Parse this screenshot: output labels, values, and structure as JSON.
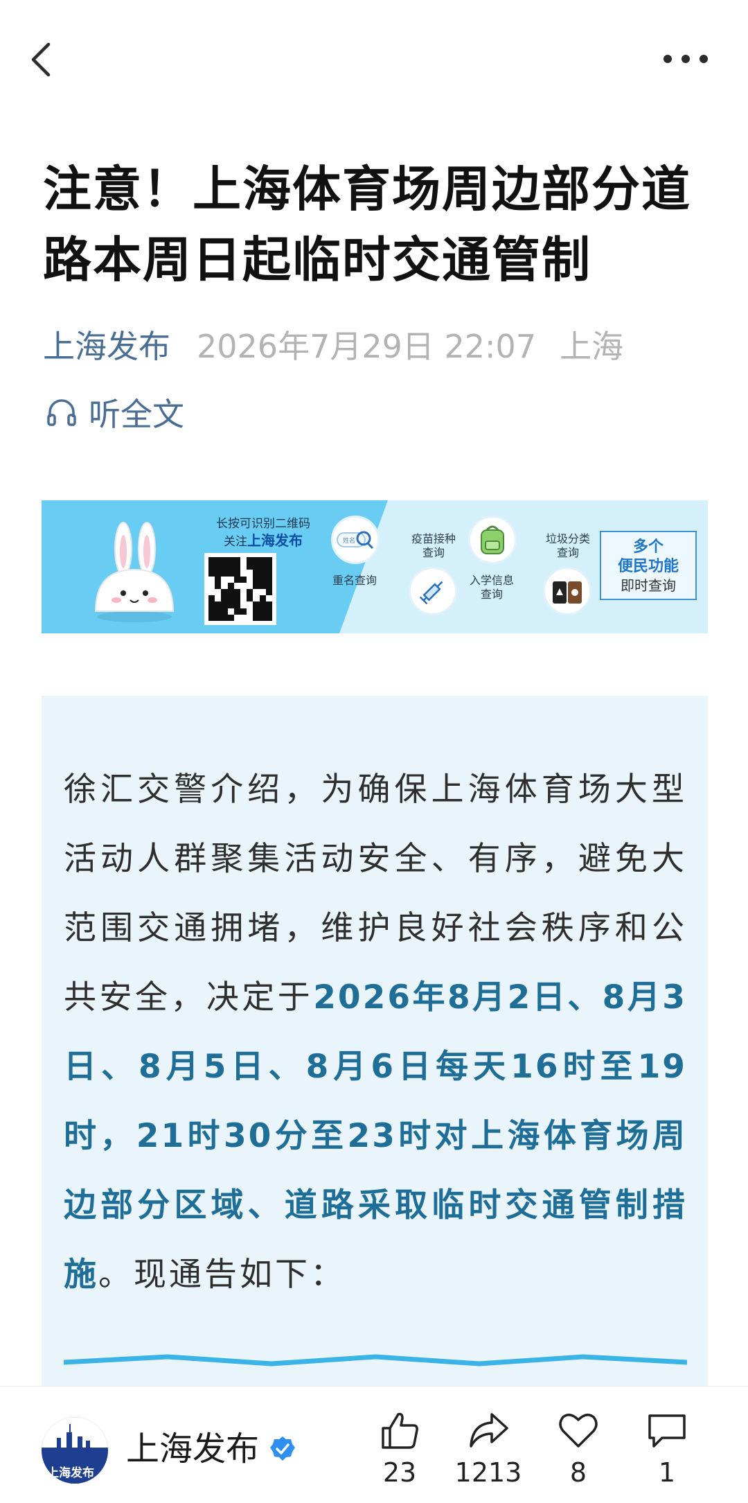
{
  "topbar": {
    "back_icon": "back-chevron-icon",
    "more_icon": "more-dots-icon"
  },
  "article": {
    "title": "注意！上海体育场周边部分道路本周日起临时交通管制",
    "author": "上海发布",
    "date": "2026年7月29日 22:07",
    "location": "上海",
    "listen_label": "听全文"
  },
  "banner": {
    "tagline_line1": "长按可识别二维码",
    "tagline_follow": "关注",
    "tagline_brand": "上海发布",
    "label_name_check": "重名查询",
    "label_vaccine_line1": "疫苗接种",
    "label_vaccine_line2": "查询",
    "label_school_line1": "入学信息",
    "label_school_line2": "查询",
    "label_garbage_line1": "垃圾分类",
    "label_garbage_line2": "查询",
    "box_line1": "多个",
    "box_line2": "便民功能",
    "box_line3": "即时查询",
    "search_chip_text": "姓名"
  },
  "content": {
    "text_before": "徐汇交警介绍，为确保上海体育场大型活动人群聚集活动安全、有序，避免大范围交通拥堵，维护良好社会秩序和公共安全，决定于",
    "text_highlight": "2026年8月2日、8月3日、8月5日、8月6日每天16时至19时，21时30分至23时对上海体育场周边部分区域、道路采取临时交通管制措施",
    "text_after": "。现通告如下："
  },
  "bottombar": {
    "account_name": "上海发布",
    "avatar_text": "上海发布",
    "like_count": "23",
    "share_count": "1213",
    "favorite_count": "8",
    "comment_count": "1"
  },
  "colors": {
    "accent": "#4a6d94",
    "highlight": "#1f6e98",
    "content_bg": "#eaf5fb",
    "verified": "#2f8ff0"
  }
}
